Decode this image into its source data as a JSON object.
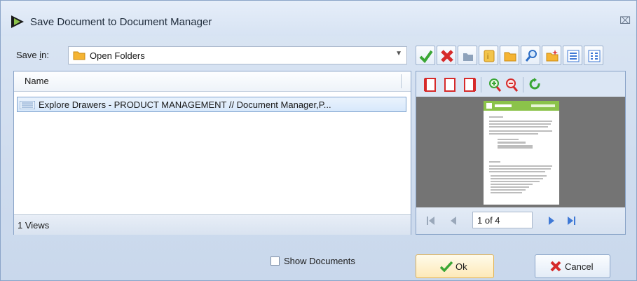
{
  "window": {
    "title": "Save Document to Document Manager",
    "close_glyph": "⌧"
  },
  "save_in": {
    "label_prefix": "Save ",
    "label_underlined": "i",
    "label_suffix": "n:",
    "value": "Open Folders"
  },
  "toolbar": {
    "icons": [
      "check-icon",
      "delete-icon",
      "up-folder-icon",
      "properties-icon",
      "open-folder-icon",
      "search-icon",
      "new-folder-icon",
      "list-view-icon",
      "details-view-icon"
    ]
  },
  "list": {
    "column_name": "Name",
    "rows": [
      {
        "text": "Explore Drawers - PRODUCT MANAGEMENT // Document Manager,P..."
      }
    ],
    "status": "1 Views"
  },
  "preview": {
    "tools": [
      "page-first-icon",
      "page-single-icon",
      "page-last-icon",
      "zoom-in-icon",
      "zoom-out-icon",
      "rotate-icon"
    ],
    "page_indicator": "1 of 4"
  },
  "show_documents": {
    "label": "Show Documents",
    "checked": false
  },
  "buttons": {
    "ok": "Ok",
    "cancel": "Cancel"
  },
  "colors": {
    "accent": "#3f79d6",
    "check_green": "#3aa635",
    "cross_red": "#d62b2b"
  }
}
